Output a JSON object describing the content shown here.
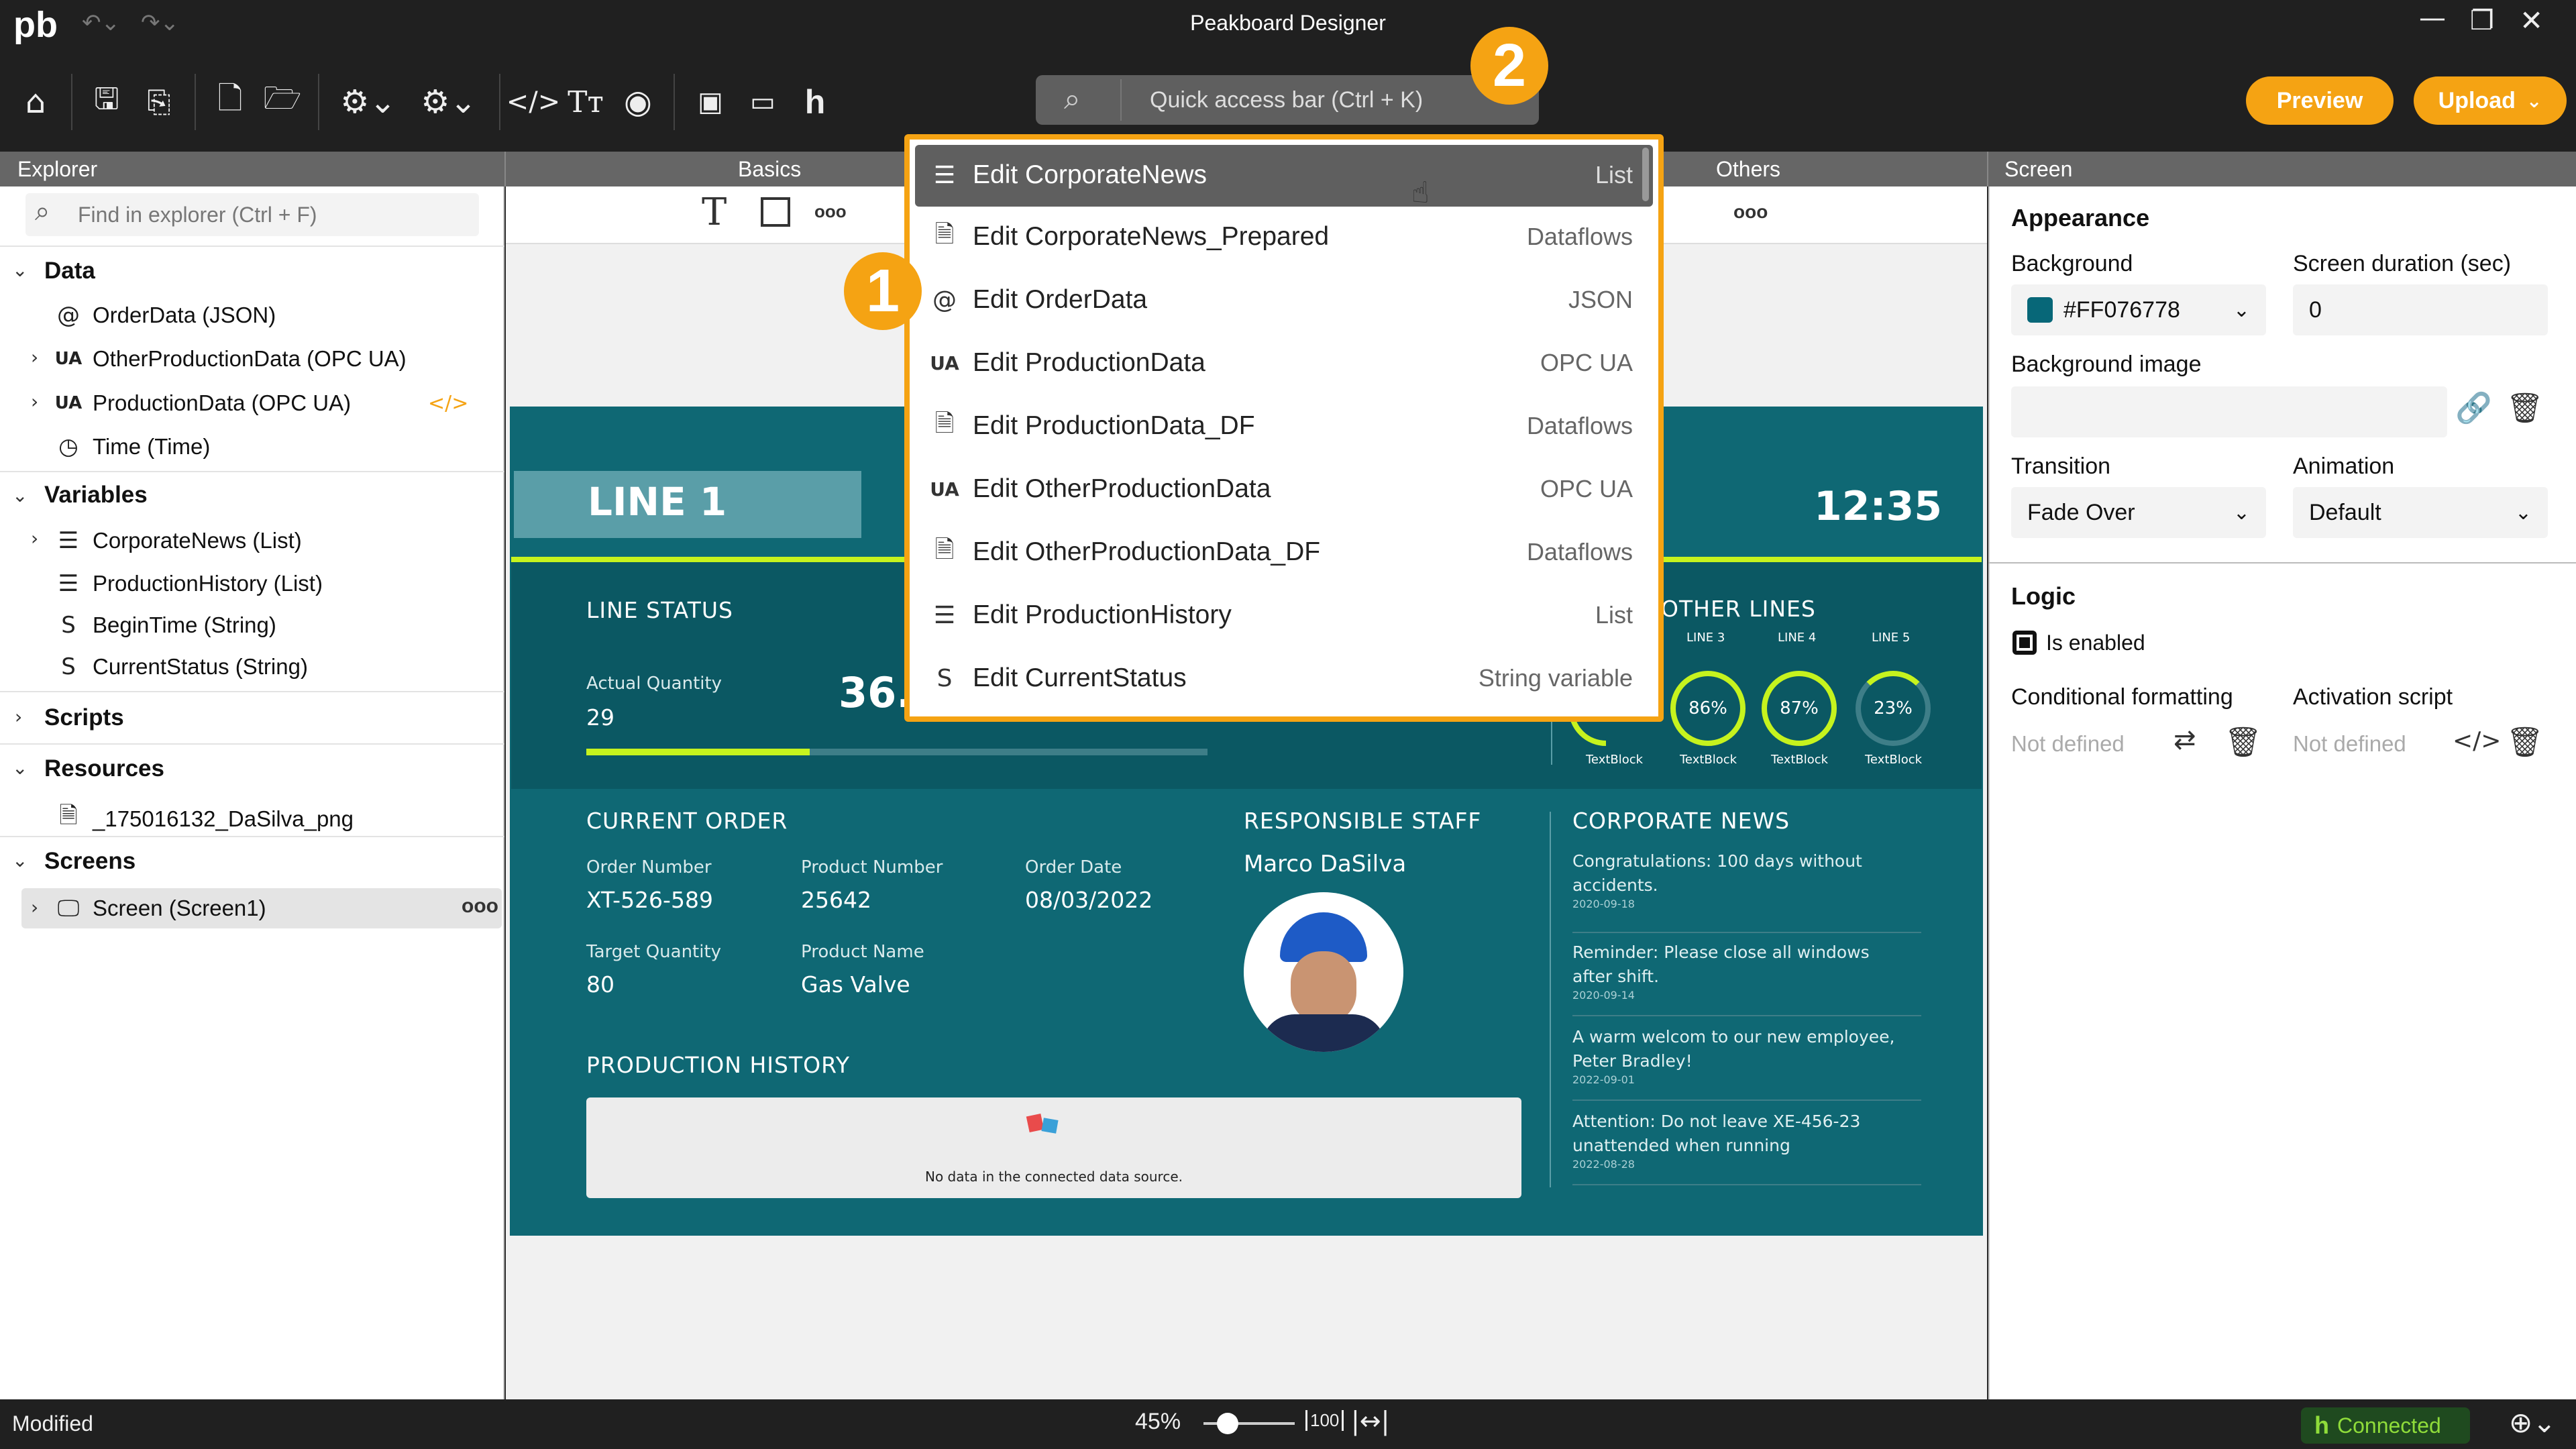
{
  "app": {
    "logo": "pb",
    "title": "Peakboard Designer"
  },
  "quick_access": {
    "placeholder": "Quick access bar (Ctrl + K)"
  },
  "actions": {
    "preview": "Preview",
    "upload": "Upload"
  },
  "panel_headers": {
    "explorer": "Explorer",
    "basics": "Basics",
    "others": "Others",
    "screen": "Screen"
  },
  "explorer": {
    "search_placeholder": "Find in explorer (Ctrl + F)",
    "data_label": "Data",
    "data_items": [
      "OrderData (JSON)",
      "OtherProductionData (OPC UA)",
      "ProductionData (OPC UA)",
      "Time (Time)"
    ],
    "variables_label": "Variables",
    "variable_items": [
      "CorporateNews (List)",
      "ProductionHistory (List)",
      "BeginTime (String)",
      "CurrentStatus (String)"
    ],
    "scripts_label": "Scripts",
    "resources_label": "Resources",
    "resource_items": [
      "_175016132_DaSilva_png"
    ],
    "screens_label": "Screens",
    "screen_items": [
      "Screen (Screen1)"
    ]
  },
  "popup": {
    "items": [
      {
        "name": "Edit CorporateNews",
        "type": "List",
        "icon": "list-icon"
      },
      {
        "name": "Edit CorporateNews_Prepared",
        "type": "Dataflows",
        "icon": "document-icon"
      },
      {
        "name": "Edit OrderData",
        "type": "JSON",
        "icon": "json-icon"
      },
      {
        "name": "Edit ProductionData",
        "type": "OPC UA",
        "icon": "opcua-icon"
      },
      {
        "name": "Edit ProductionData_DF",
        "type": "Dataflows",
        "icon": "document-icon"
      },
      {
        "name": "Edit OtherProductionData",
        "type": "OPC UA",
        "icon": "opcua-icon"
      },
      {
        "name": "Edit OtherProductionData_DF",
        "type": "Dataflows",
        "icon": "document-icon"
      },
      {
        "name": "Edit ProductionHistory",
        "type": "List",
        "icon": "list-icon"
      },
      {
        "name": "Edit CurrentStatus",
        "type": "String variable",
        "icon": "string-icon"
      }
    ],
    "badge1": "1",
    "badge2": "2"
  },
  "dashboard": {
    "line_title": "LINE 1",
    "clock": "12:35",
    "line_status": "LINE STATUS",
    "actual_qty_label": "Actual Quantity",
    "actual_qty_value": "29",
    "big_value": "36.3",
    "actual_qty_progress": 0.36,
    "other_lines": "OTHER LINES",
    "gauges": [
      {
        "line": "LINE 3",
        "value": "86%",
        "caption": "TextBlock",
        "fraction": 0.86
      },
      {
        "line": "LINE 4",
        "value": "87%",
        "caption": "TextBlock",
        "fraction": 0.87
      },
      {
        "line": "LINE 5",
        "value": "23%",
        "caption": "TextBlock",
        "fraction": 0.23
      }
    ],
    "gauge_partial_caption": "TextBlock",
    "current_order": "CURRENT ORDER",
    "order_number_label": "Order Number",
    "order_number": "XT-526-589",
    "product_number_label": "Product Number",
    "product_number": "25642",
    "order_date_label": "Order Date",
    "order_date": "08/03/2022",
    "target_qty_label": "Target Quantity",
    "target_qty": "80",
    "product_name_label": "Product Name",
    "product_name": "Gas Valve",
    "staff_title": "RESPONSIBLE STAFF",
    "staff_name": "Marco DaSilva",
    "history_title": "PRODUCTION HISTORY",
    "history_empty": "No data in the connected data source.",
    "news_title": "CORPORATE NEWS",
    "news": [
      {
        "text": "Congratulations: 100 days without accidents.",
        "date": "2020-09-18"
      },
      {
        "text": "Reminder: Please close all windows after shift.",
        "date": "2020-09-14"
      },
      {
        "text": "A warm welcom to our new employee, Peter Bradley!",
        "date": "2022-09-01"
      },
      {
        "text": "Attention: Do not leave XE-456-23 unattended when running",
        "date": "2022-08-28"
      }
    ]
  },
  "properties": {
    "appearance": "Appearance",
    "background_label": "Background",
    "background_value": "#FF076778",
    "background_swatch": "#076778",
    "duration_label": "Screen duration (sec)",
    "duration_value": "0",
    "bgimage_label": "Background image",
    "transition_label": "Transition",
    "transition_value": "Fade Over",
    "animation_label": "Animation",
    "animation_value": "Default",
    "logic": "Logic",
    "enabled_label": "Is enabled",
    "condfmt_label": "Conditional formatting",
    "condfmt_value": "Not defined",
    "activation_label": "Activation script",
    "activation_value": "Not defined"
  },
  "status": {
    "state": "Modified",
    "zoom": "45%",
    "zoom_fraction": 0.45,
    "connected": "Connected"
  }
}
